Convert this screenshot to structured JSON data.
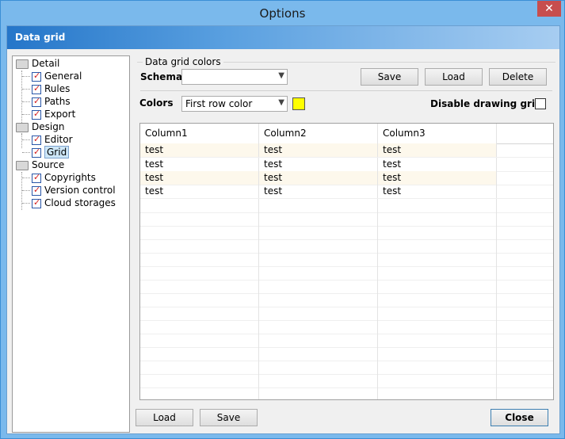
{
  "window": {
    "title": "Options",
    "close_glyph": "✕"
  },
  "header": {
    "title": "Data grid"
  },
  "tree": {
    "items": [
      {
        "label": "Detail",
        "type": "folder"
      },
      {
        "label": "General",
        "type": "leaf"
      },
      {
        "label": "Rules",
        "type": "leaf"
      },
      {
        "label": "Paths",
        "type": "leaf"
      },
      {
        "label": "Export",
        "type": "leaf"
      },
      {
        "label": "Design",
        "type": "folder"
      },
      {
        "label": "Editor",
        "type": "leaf"
      },
      {
        "label": "Grid",
        "type": "leaf",
        "selected": true
      },
      {
        "label": "Source",
        "type": "folder"
      },
      {
        "label": "Copyrights",
        "type": "leaf"
      },
      {
        "label": "Version control",
        "type": "leaf"
      },
      {
        "label": "Cloud storages",
        "type": "leaf"
      }
    ]
  },
  "panel": {
    "group_label": "Data grid colors",
    "schema_label": "Schema",
    "schema_value": "",
    "save_label": "Save",
    "load_label": "Load",
    "delete_label": "Delete",
    "colors_label": "Colors",
    "colors_value": "First row color",
    "swatch_color": "#ffff00",
    "disable_label": "Disable drawing grid",
    "disable_checked": false
  },
  "grid": {
    "columns": [
      "Column1",
      "Column2",
      "Column3"
    ],
    "rows": [
      [
        "test",
        "test",
        "test"
      ],
      [
        "test",
        "test",
        "test"
      ],
      [
        "test",
        "test",
        "test"
      ],
      [
        "test",
        "test",
        "test"
      ]
    ]
  },
  "footer": {
    "load_label": "Load",
    "save_label": "Save",
    "close_label": "Close"
  }
}
